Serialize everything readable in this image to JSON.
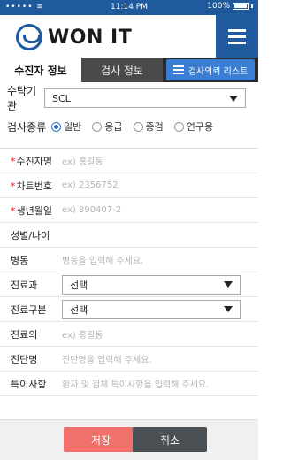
{
  "status_bar": {
    "signal": "•••••",
    "wifi": "≋",
    "time": "11:14 PM",
    "battery": "100%"
  },
  "header": {
    "logo_text": "WON IT"
  },
  "tabs": [
    {
      "label": "수진자 정보",
      "active": true
    },
    {
      "label": "검사 정보",
      "active": false
    }
  ],
  "request_list_button": "검사의뢰 리스트",
  "institution": {
    "label": "수탁기관",
    "value": "SCL"
  },
  "test_type": {
    "label": "검사종류",
    "options": [
      "일반",
      "응급",
      "종검",
      "연구용"
    ],
    "selected": "일반"
  },
  "form": {
    "patient_name": {
      "label": "수진자명",
      "placeholder": "ex) 홍길동",
      "required": true
    },
    "chart_number": {
      "label": "차트번호",
      "placeholder": "ex) 2356752",
      "required": true
    },
    "birth_date": {
      "label": "생년월일",
      "placeholder": "ex) 890407-2",
      "required": true
    },
    "sex_age": {
      "label": "성별/나이",
      "placeholder": ""
    },
    "ward": {
      "label": "병동",
      "placeholder": "병동을 입력해 주세요."
    },
    "department": {
      "label": "진료과",
      "value": "선택"
    },
    "care_type": {
      "label": "진료구분",
      "value": "선택"
    },
    "doctor": {
      "label": "진료의",
      "placeholder": "ex) 홍길동"
    },
    "diagnosis": {
      "label": "진단명",
      "placeholder": "진단명을 입력해 주세요."
    },
    "notes": {
      "label": "특이사항",
      "placeholder": "환자 및 검체 특이사항을 입력해 주세요."
    }
  },
  "buttons": {
    "save": "저장",
    "cancel": "취소"
  },
  "colors": {
    "brand_blue": "#1e5a9c",
    "accent_blue": "#3a7fd4",
    "save_red": "#f0716b",
    "cancel_dark": "#4a5053"
  }
}
